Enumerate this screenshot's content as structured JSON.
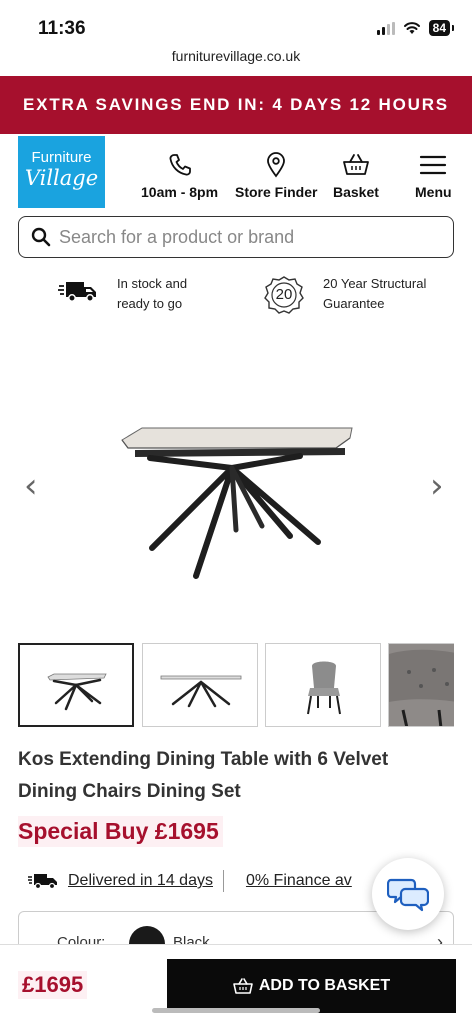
{
  "status": {
    "time": "11:36",
    "battery": "84"
  },
  "browser": {
    "url": "furniturevillage.co.uk"
  },
  "promo": {
    "text": "EXTRA SAVINGS END IN: 4 DAYS 12 HOURS"
  },
  "logo": {
    "line1": "Furniture",
    "line2": "Village"
  },
  "nav": [
    {
      "label": "10am - 8pm",
      "icon": "phone-icon"
    },
    {
      "label": "Store Finder",
      "icon": "location-pin-icon"
    },
    {
      "label": "Basket",
      "icon": "basket-icon"
    },
    {
      "label": "Menu",
      "icon": "hamburger-menu-icon"
    }
  ],
  "search": {
    "placeholder": "Search for a product or brand"
  },
  "usps": [
    {
      "line1": "In stock and",
      "line2": "ready to go",
      "icon": "delivery-van-icon"
    },
    {
      "line1": "20 Year Structural",
      "line2": "Guarantee",
      "badge": "20",
      "icon": "guarantee-badge-icon"
    }
  ],
  "gallery": {
    "prev": "‹",
    "next": "›",
    "thumbnails": [
      "table-angle",
      "table-side",
      "chair",
      "chair-closeup"
    ]
  },
  "product": {
    "title": "Kos Extending Dining Table with 6 Velvet Dining Chairs Dining Set",
    "price_label": "Special Buy £1695",
    "delivery": "Delivered in 14 days",
    "finance": "0% Finance av",
    "colour_label": "Colour:",
    "colour_value": "Black",
    "colour_hex": "#1a1a1a"
  },
  "bottom": {
    "price": "£1695",
    "add_to_basket": "ADD TO BASKET"
  },
  "colors": {
    "brand_red": "#a6102d",
    "brand_blue": "#1aa3df",
    "button_black": "#0a0a0a"
  }
}
